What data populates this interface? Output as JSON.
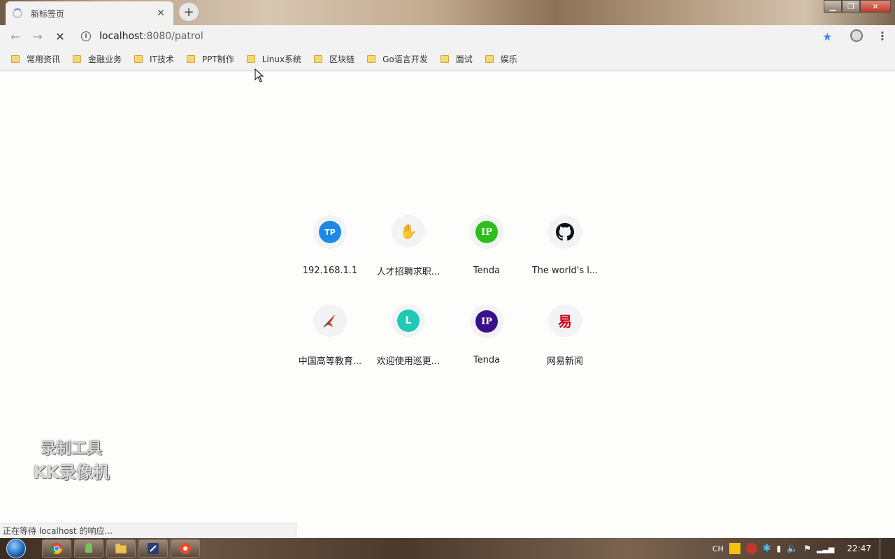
{
  "window": {
    "tab_title": "新标签页",
    "tab_close": "✕",
    "new_tab": "+"
  },
  "toolbar": {
    "url_host": "localhost",
    "url_rest": ":8080/patrol"
  },
  "bookmarks": [
    {
      "label": "常用资讯"
    },
    {
      "label": "金融业务"
    },
    {
      "label": "IT技术"
    },
    {
      "label": "PPT制作"
    },
    {
      "label": "Linux系统"
    },
    {
      "label": "区块链"
    },
    {
      "label": "Go语言开发"
    },
    {
      "label": "面试"
    },
    {
      "label": "娱乐"
    }
  ],
  "shortcuts": [
    {
      "label": "192.168.1.1",
      "icon_text": "TP",
      "icon": "tp-link-icon",
      "color": "#1e88e5"
    },
    {
      "label": "人才招聘求职...",
      "icon_text": "✋",
      "icon": "hand-icon",
      "color": "#f1f3f4"
    },
    {
      "label": "Tenda",
      "icon_text": "IP",
      "icon": "ip-icon",
      "color": "#2ebd1c"
    },
    {
      "label": "The world's l...",
      "icon_text": "",
      "icon": "github-icon",
      "color": "#111111"
    },
    {
      "label": "中国高等教育...",
      "icon_text": "",
      "icon": "chsi-icon",
      "color": "#f1f3f4"
    },
    {
      "label": "欢迎使用巡更...",
      "icon_text": "L",
      "icon": "letter-l-icon",
      "color": "#1ec9b5"
    },
    {
      "label": "Tenda",
      "icon_text": "IP",
      "icon": "ip-icon",
      "color": "#3b0f8c"
    },
    {
      "label": "网易新闻",
      "icon_text": "易",
      "icon": "netease-icon",
      "color": "#f1f3f4"
    }
  ],
  "watermark": {
    "line1": "录制工具",
    "line2": "KK录像机"
  },
  "status": {
    "text": "正在等待 localhost 的响应..."
  },
  "taskbar": {
    "lang": "CH",
    "clock": "22:47"
  }
}
